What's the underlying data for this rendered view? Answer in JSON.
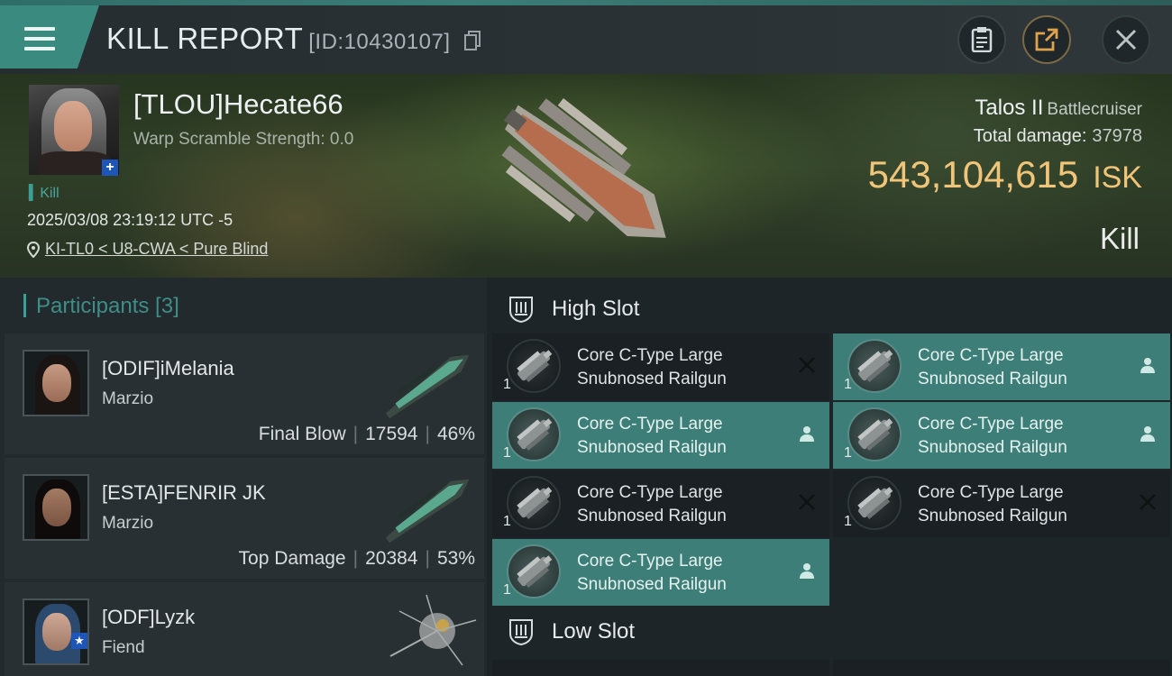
{
  "header": {
    "title": "KILL REPORT",
    "report_id": "[ID:10430107]"
  },
  "victim": {
    "name": "[TLOU]Hecate66",
    "warp_scramble": "Warp Scramble Strength: 0.0",
    "kill_tag": "Kill",
    "timestamp": "2025/03/08 23:19:12 UTC -5",
    "location": "KI-TL0 < U8-CWA < Pure Blind",
    "ship": "Talos II",
    "ship_class": "Battlecruiser",
    "total_damage_label": "Total damage:",
    "total_damage": "37978",
    "isk_value": "543,104,615",
    "isk_unit": "ISK",
    "result": "Kill"
  },
  "participants": {
    "label": "Participants [3]",
    "items": [
      {
        "name": "[ODIF]iMelania",
        "ship": "Marzio",
        "role": "Final Blow",
        "damage": "17594",
        "percent": "46%"
      },
      {
        "name": "[ESTA]FENRIR JK",
        "ship": "Marzio",
        "role": "Top Damage",
        "damage": "20384",
        "percent": "53%"
      },
      {
        "name": "[ODF]Lyzk",
        "ship": "Fiend"
      }
    ]
  },
  "slots": {
    "high_label": "High Slot",
    "low_label": "Low Slot",
    "high_modules": [
      {
        "qty": "1",
        "line1": "Core C-Type Large",
        "line2": "Snubnosed Railgun",
        "status": "destroyed"
      },
      {
        "qty": "1",
        "line1": "Core C-Type Large",
        "line2": "Snubnosed Railgun",
        "status": "dropped"
      },
      {
        "qty": "1",
        "line1": "Core C-Type Large",
        "line2": "Snubnosed Railgun",
        "status": "dropped"
      },
      {
        "qty": "1",
        "line1": "Core C-Type Large",
        "line2": "Snubnosed Railgun",
        "status": "dropped"
      },
      {
        "qty": "1",
        "line1": "Core C-Type Large",
        "line2": "Snubnosed Railgun",
        "status": "destroyed"
      },
      {
        "qty": "1",
        "line1": "Core C-Type Large",
        "line2": "Snubnosed Railgun",
        "status": "destroyed"
      },
      {
        "qty": "1",
        "line1": "Core C-Type Large",
        "line2": "Snubnosed Railgun",
        "status": "dropped"
      }
    ]
  }
}
